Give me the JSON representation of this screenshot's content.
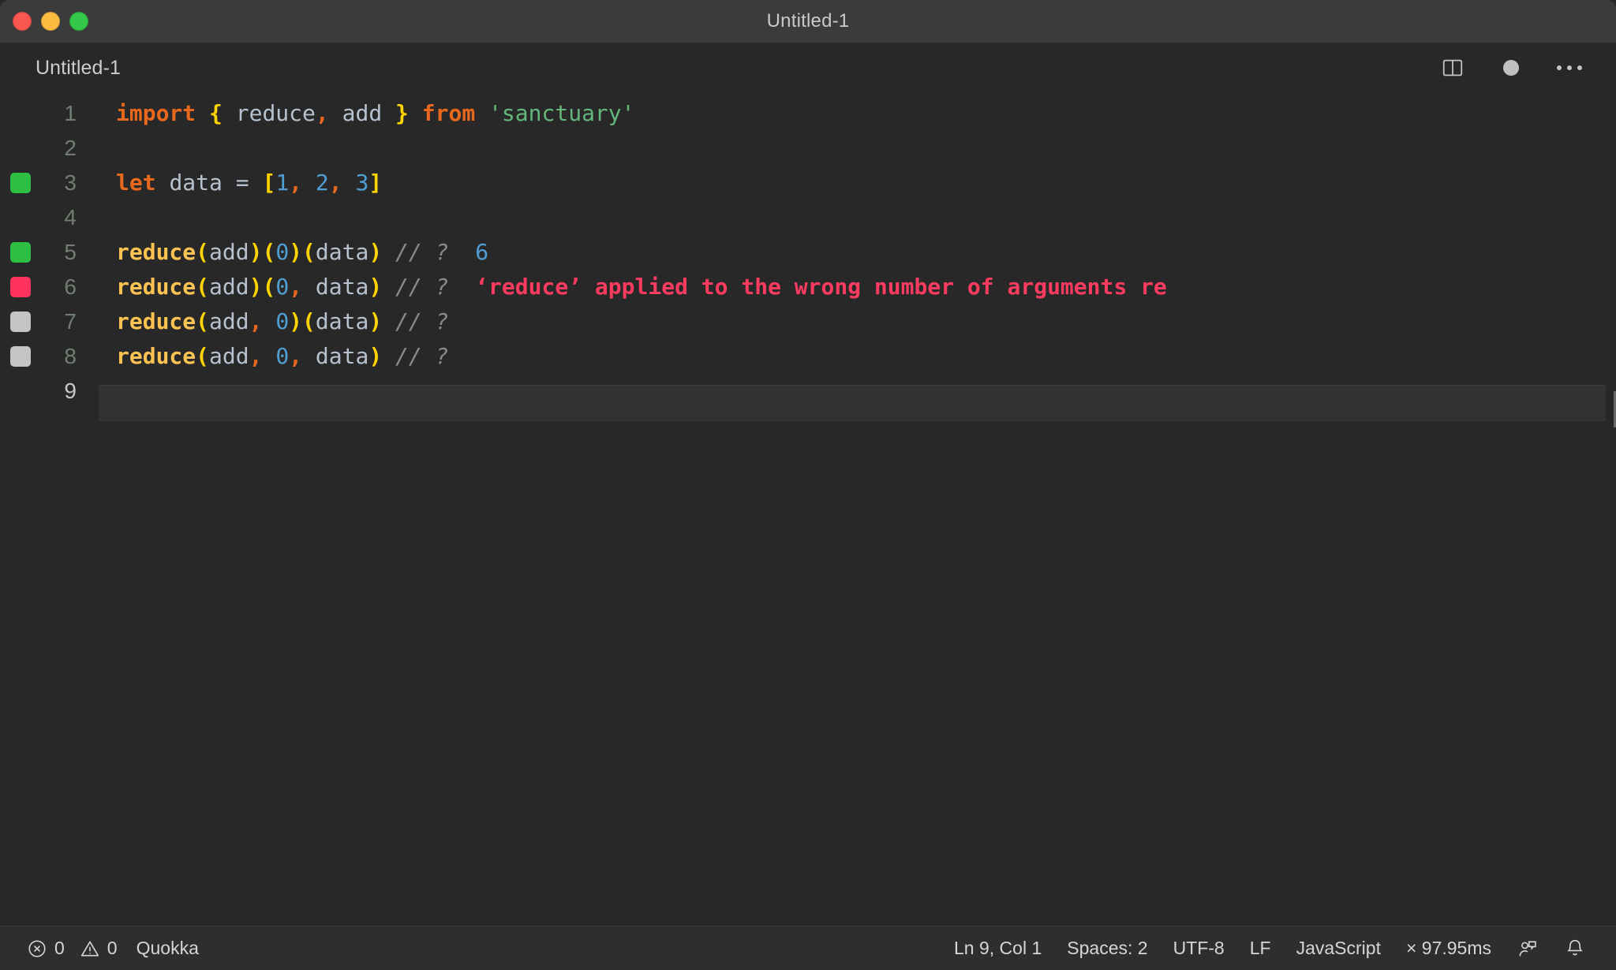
{
  "window": {
    "title": "Untitled-1",
    "traffic_lights": [
      "close",
      "minimize",
      "maximize"
    ]
  },
  "tab": {
    "label": "Untitled-1",
    "dirty": true
  },
  "editor_actions": {
    "split_editor_label": "Split Editor",
    "unsaved_dot_label": "Unsaved changes",
    "more_actions_label": "More Actions..."
  },
  "editor": {
    "language": "JavaScript",
    "lines": [
      {
        "number": "1",
        "marker": "none",
        "active": false,
        "tokens": [
          {
            "text": "import",
            "type": "kw"
          },
          {
            "text": " ",
            "type": "plain"
          },
          {
            "text": "{",
            "type": "brace"
          },
          {
            "text": " ",
            "type": "plain"
          },
          {
            "text": "reduce",
            "type": "var"
          },
          {
            "text": ",",
            "type": "punc"
          },
          {
            "text": " ",
            "type": "plain"
          },
          {
            "text": "add",
            "type": "var"
          },
          {
            "text": " ",
            "type": "plain"
          },
          {
            "text": "}",
            "type": "brace"
          },
          {
            "text": " ",
            "type": "plain"
          },
          {
            "text": "from",
            "type": "kw"
          },
          {
            "text": " ",
            "type": "plain"
          },
          {
            "text": "'sanctuary'",
            "type": "str"
          }
        ]
      },
      {
        "number": "2",
        "marker": "none",
        "active": false,
        "tokens": []
      },
      {
        "number": "3",
        "marker": "green",
        "active": false,
        "tokens": [
          {
            "text": "let",
            "type": "kw"
          },
          {
            "text": " ",
            "type": "plain"
          },
          {
            "text": "data",
            "type": "var"
          },
          {
            "text": " ",
            "type": "plain"
          },
          {
            "text": "=",
            "type": "op"
          },
          {
            "text": " ",
            "type": "plain"
          },
          {
            "text": "[",
            "type": "brace"
          },
          {
            "text": "1",
            "type": "num"
          },
          {
            "text": ",",
            "type": "punc"
          },
          {
            "text": " ",
            "type": "plain"
          },
          {
            "text": "2",
            "type": "num"
          },
          {
            "text": ",",
            "type": "punc"
          },
          {
            "text": " ",
            "type": "plain"
          },
          {
            "text": "3",
            "type": "num"
          },
          {
            "text": "]",
            "type": "brace"
          }
        ]
      },
      {
        "number": "4",
        "marker": "none",
        "active": false,
        "tokens": []
      },
      {
        "number": "5",
        "marker": "green",
        "active": false,
        "tokens": [
          {
            "text": "reduce",
            "type": "fn"
          },
          {
            "text": "(",
            "type": "paren"
          },
          {
            "text": "add",
            "type": "var"
          },
          {
            "text": ")",
            "type": "paren"
          },
          {
            "text": "(",
            "type": "paren"
          },
          {
            "text": "0",
            "type": "num"
          },
          {
            "text": ")",
            "type": "paren"
          },
          {
            "text": "(",
            "type": "paren"
          },
          {
            "text": "data",
            "type": "var"
          },
          {
            "text": ")",
            "type": "paren"
          },
          {
            "text": " ",
            "type": "plain"
          },
          {
            "text": "// ?",
            "type": "comment"
          },
          {
            "text": "  ",
            "type": "plain"
          },
          {
            "text": "6",
            "type": "val"
          }
        ]
      },
      {
        "number": "6",
        "marker": "red",
        "active": false,
        "tokens": [
          {
            "text": "reduce",
            "type": "fn"
          },
          {
            "text": "(",
            "type": "paren"
          },
          {
            "text": "add",
            "type": "var"
          },
          {
            "text": ")",
            "type": "paren"
          },
          {
            "text": "(",
            "type": "paren"
          },
          {
            "text": "0",
            "type": "num"
          },
          {
            "text": ",",
            "type": "punc"
          },
          {
            "text": " ",
            "type": "plain"
          },
          {
            "text": "data",
            "type": "var"
          },
          {
            "text": ")",
            "type": "paren"
          },
          {
            "text": " ",
            "type": "plain"
          },
          {
            "text": "// ?",
            "type": "comment"
          },
          {
            "text": "  ",
            "type": "plain"
          },
          {
            "text": "‘reduce’ applied to the wrong number of arguments re",
            "type": "err"
          }
        ]
      },
      {
        "number": "7",
        "marker": "grey",
        "active": false,
        "tokens": [
          {
            "text": "reduce",
            "type": "fn"
          },
          {
            "text": "(",
            "type": "paren"
          },
          {
            "text": "add",
            "type": "var"
          },
          {
            "text": ",",
            "type": "punc"
          },
          {
            "text": " ",
            "type": "plain"
          },
          {
            "text": "0",
            "type": "num"
          },
          {
            "text": ")",
            "type": "paren"
          },
          {
            "text": "(",
            "type": "paren"
          },
          {
            "text": "data",
            "type": "var"
          },
          {
            "text": ")",
            "type": "paren"
          },
          {
            "text": " ",
            "type": "plain"
          },
          {
            "text": "// ?",
            "type": "comment"
          }
        ]
      },
      {
        "number": "8",
        "marker": "grey",
        "active": false,
        "tokens": [
          {
            "text": "reduce",
            "type": "fn"
          },
          {
            "text": "(",
            "type": "paren"
          },
          {
            "text": "add",
            "type": "var"
          },
          {
            "text": ",",
            "type": "punc"
          },
          {
            "text": " ",
            "type": "plain"
          },
          {
            "text": "0",
            "type": "num"
          },
          {
            "text": ",",
            "type": "punc"
          },
          {
            "text": " ",
            "type": "plain"
          },
          {
            "text": "data",
            "type": "var"
          },
          {
            "text": ")",
            "type": "paren"
          },
          {
            "text": " ",
            "type": "plain"
          },
          {
            "text": "// ?",
            "type": "comment"
          }
        ]
      },
      {
        "number": "9",
        "marker": "none",
        "active": true,
        "tokens": []
      }
    ]
  },
  "statusbar": {
    "errors_count": "0",
    "warnings_count": "0",
    "errors_icon": "error-circle-x-icon",
    "warnings_icon": "warning-triangle-icon",
    "quokka_label": "Quokka",
    "cursor_position": "Ln 9, Col 1",
    "indentation": "Spaces: 2",
    "encoding": "UTF-8",
    "eol": "LF",
    "language": "JavaScript",
    "run_time": "× 97.95ms",
    "feedback_icon": "feedback-person-icon",
    "notifications_icon": "bell-icon"
  },
  "colors": {
    "titlebar_bg": "#3b3b3b",
    "editor_bg": "#282828",
    "statusbar_bg": "#2e2e2e",
    "keyword": "#e8681d",
    "string": "#63b77c",
    "number": "#4f9fd4",
    "function": "#fcc352",
    "bracket": "#ffd400",
    "variable": "#b6c2cf",
    "comment": "#8a8a8a",
    "error": "#fb3b5f",
    "marker_green": "#2fbe44",
    "marker_red": "#ff335e",
    "marker_grey": "#c4c4c4"
  }
}
